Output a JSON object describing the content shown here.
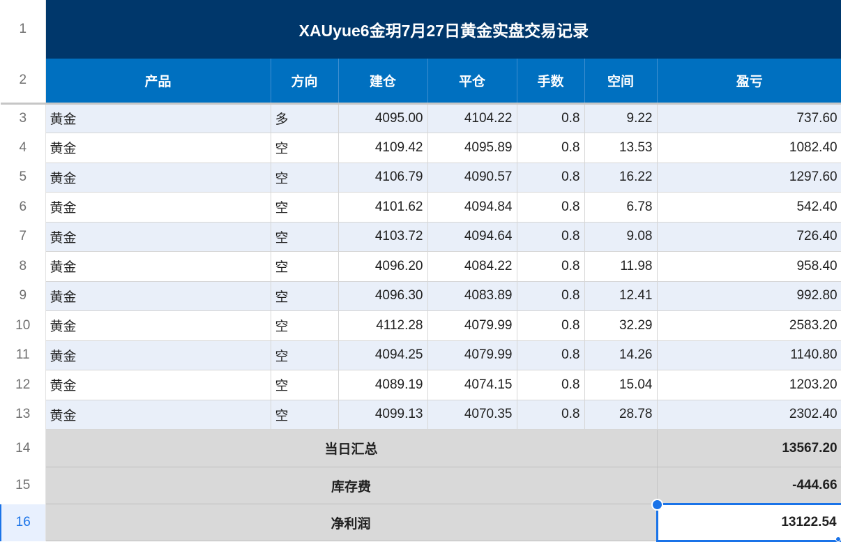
{
  "sheet": {
    "title": "XAUyue6金玥7月27日黄金实盘交易记录",
    "row_numbers": [
      "1",
      "2",
      "3",
      "4",
      "5",
      "6",
      "7",
      "8",
      "9",
      "10",
      "11",
      "12",
      "13",
      "14",
      "15",
      "16"
    ],
    "headers": [
      "产品",
      "方向",
      "建仓",
      "平仓",
      "手数",
      "空间",
      "盈亏"
    ],
    "rows": [
      [
        "黄金",
        "多",
        "4095.00",
        "4104.22",
        "0.8",
        "9.22",
        "737.60"
      ],
      [
        "黄金",
        "空",
        "4109.42",
        "4095.89",
        "0.8",
        "13.53",
        "1082.40"
      ],
      [
        "黄金",
        "空",
        "4106.79",
        "4090.57",
        "0.8",
        "16.22",
        "1297.60"
      ],
      [
        "黄金",
        "空",
        "4101.62",
        "4094.84",
        "0.8",
        "6.78",
        "542.40"
      ],
      [
        "黄金",
        "空",
        "4103.72",
        "4094.64",
        "0.8",
        "9.08",
        "726.40"
      ],
      [
        "黄金",
        "空",
        "4096.20",
        "4084.22",
        "0.8",
        "11.98",
        "958.40"
      ],
      [
        "黄金",
        "空",
        "4096.30",
        "4083.89",
        "0.8",
        "12.41",
        "992.80"
      ],
      [
        "黄金",
        "空",
        "4112.28",
        "4079.99",
        "0.8",
        "32.29",
        "2583.20"
      ],
      [
        "黄金",
        "空",
        "4094.25",
        "4079.99",
        "0.8",
        "14.26",
        "1140.80"
      ],
      [
        "黄金",
        "空",
        "4089.19",
        "4074.15",
        "0.8",
        "15.04",
        "1203.20"
      ],
      [
        "黄金",
        "空",
        "4099.13",
        "4070.35",
        "0.8",
        "28.78",
        "2302.40"
      ]
    ],
    "summary": [
      {
        "label": "当日汇总",
        "value": "13567.20"
      },
      {
        "label": "库存费",
        "value": "-444.66"
      },
      {
        "label": "净利润",
        "value": "13122.54"
      }
    ]
  },
  "colors": {
    "title_bg": "#00376b",
    "header_bg": "#0070c0",
    "odd_row_bg": "#e9eff9",
    "summary_bg": "#d9d9d9",
    "selection": "#1a73e8"
  }
}
